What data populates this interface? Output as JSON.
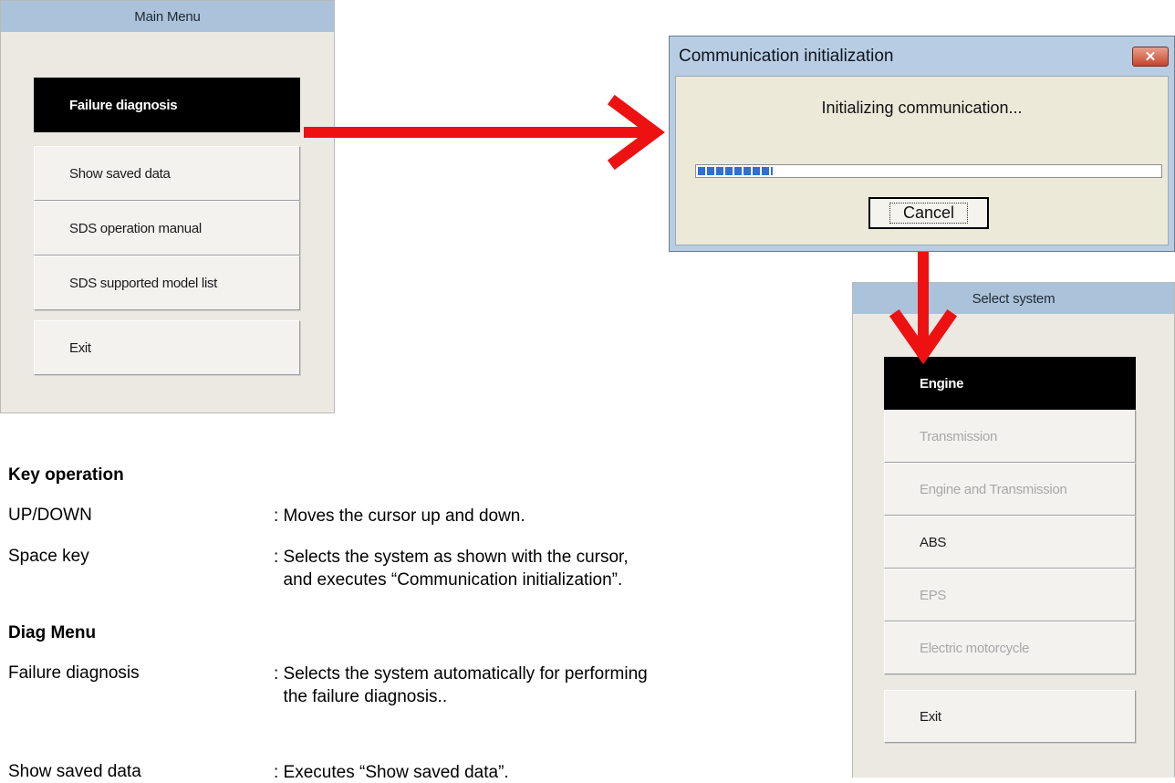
{
  "main_menu": {
    "title": "Main Menu",
    "items": [
      {
        "label": "Failure diagnosis",
        "state": "selected"
      },
      {
        "label": "Show saved data",
        "state": "normal"
      },
      {
        "label": "SDS operation manual",
        "state": "normal"
      },
      {
        "label": "SDS supported model list",
        "state": "normal"
      },
      {
        "label": "Exit",
        "state": "normal"
      }
    ]
  },
  "comm_dialog": {
    "title": "Communication initialization",
    "close_label": "✕",
    "message": "Initializing communication...",
    "progress_fraction": 0.16,
    "cancel_label": "Cancel"
  },
  "select_system": {
    "title": "Select system",
    "items": [
      {
        "label": "Engine",
        "state": "selected"
      },
      {
        "label": "Transmission",
        "state": "disabled"
      },
      {
        "label": "Engine and Transmission",
        "state": "disabled"
      },
      {
        "label": "ABS",
        "state": "normal"
      },
      {
        "label": "EPS",
        "state": "disabled"
      },
      {
        "label": "Electric motorcycle",
        "state": "disabled"
      },
      {
        "label": "Exit",
        "state": "normal"
      }
    ]
  },
  "instructions": {
    "key_operation_heading": "Key operation",
    "key_rows": [
      {
        "key": "UP/DOWN",
        "desc": ": Moves the cursor up and down."
      },
      {
        "key": "Space key",
        "desc": ": Selects the system as shown with the cursor,",
        "desc2": "  and executes “Communication initialization”."
      }
    ],
    "diag_menu_heading": "Diag Menu",
    "diag_rows": [
      {
        "key": "Failure diagnosis",
        "desc": ": Selects the system automatically for performing",
        "desc2": "  the failure diagnosis.."
      },
      {
        "key": "Show saved data",
        "desc": ": Executes “Show saved data”."
      }
    ]
  },
  "colors": {
    "arrow": "#ee1111",
    "title_bar": "#abc3da",
    "selected": "#000000"
  }
}
